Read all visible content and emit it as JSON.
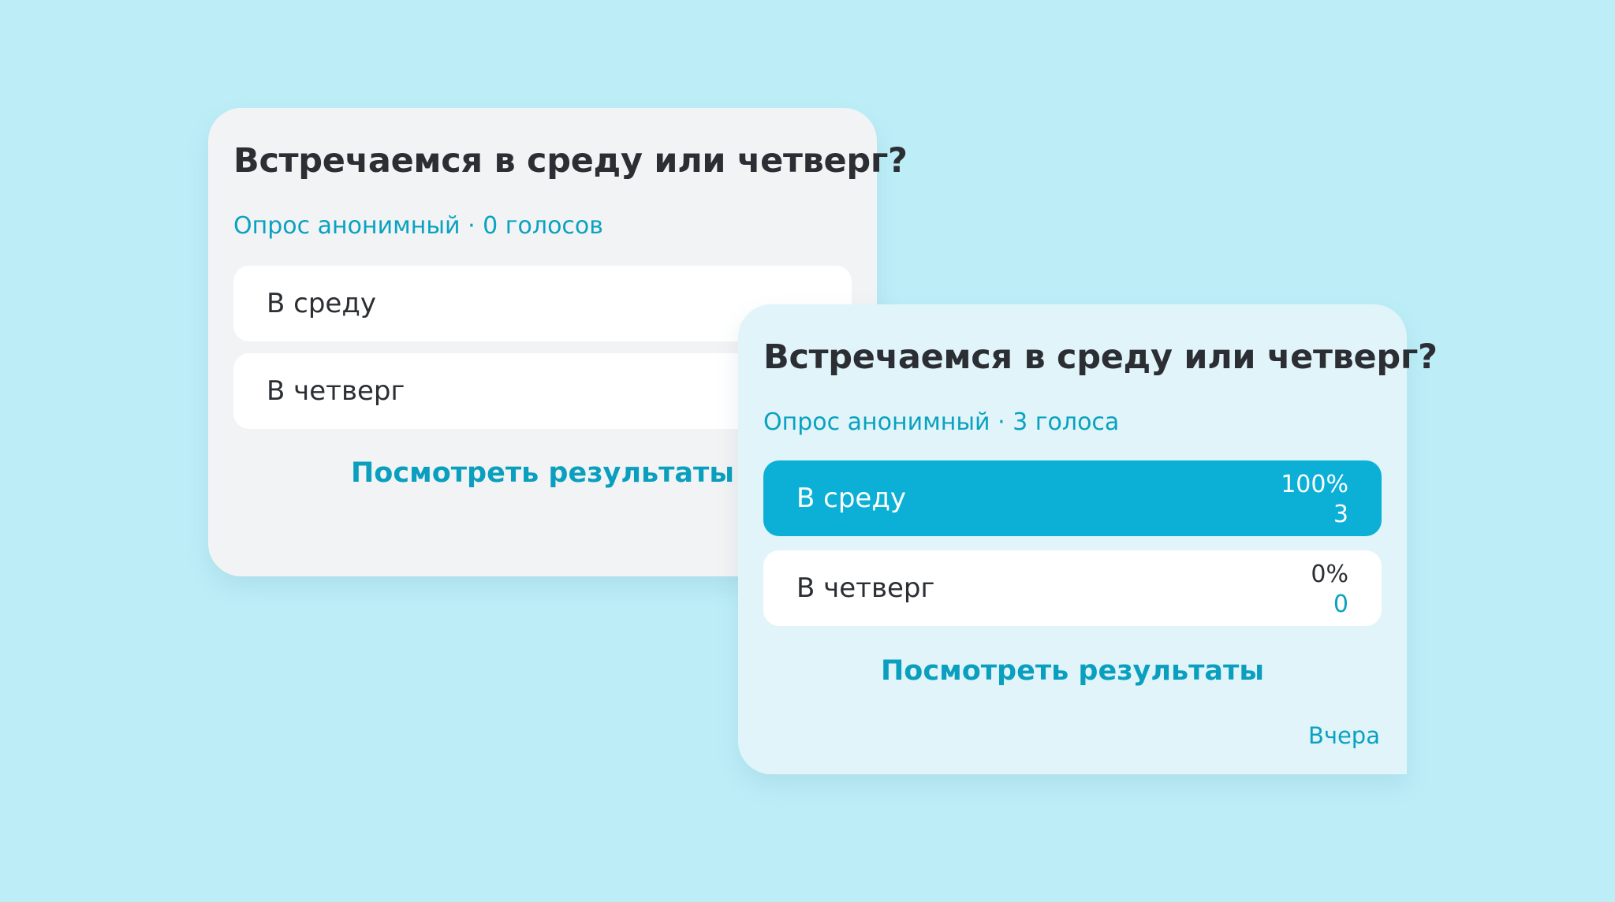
{
  "poll_unvoted": {
    "question": "Встречаемся в среду или четверг?",
    "meta": "Опрос анонимный · 0 голосов",
    "options": [
      {
        "label": "В среду"
      },
      {
        "label": "В четверг"
      }
    ],
    "results_link": "Посмотреть результаты"
  },
  "poll_voted": {
    "question": "Встречаемся в среду или четверг?",
    "meta": "Опрос анонимный · 3 голоса",
    "options": [
      {
        "label": "В среду",
        "percent": "100%",
        "count": "3",
        "selected": true
      },
      {
        "label": "В четверг",
        "percent": "0%",
        "count": "0",
        "selected": false
      }
    ],
    "results_link": "Посмотреть результаты",
    "timestamp": "Вчера"
  },
  "colors": {
    "background": "#bdeef8",
    "accent": "#0cb0d6",
    "link": "#0a9fbf",
    "card_left": "#f2f3f5",
    "card_right": "#e0f4fa"
  }
}
